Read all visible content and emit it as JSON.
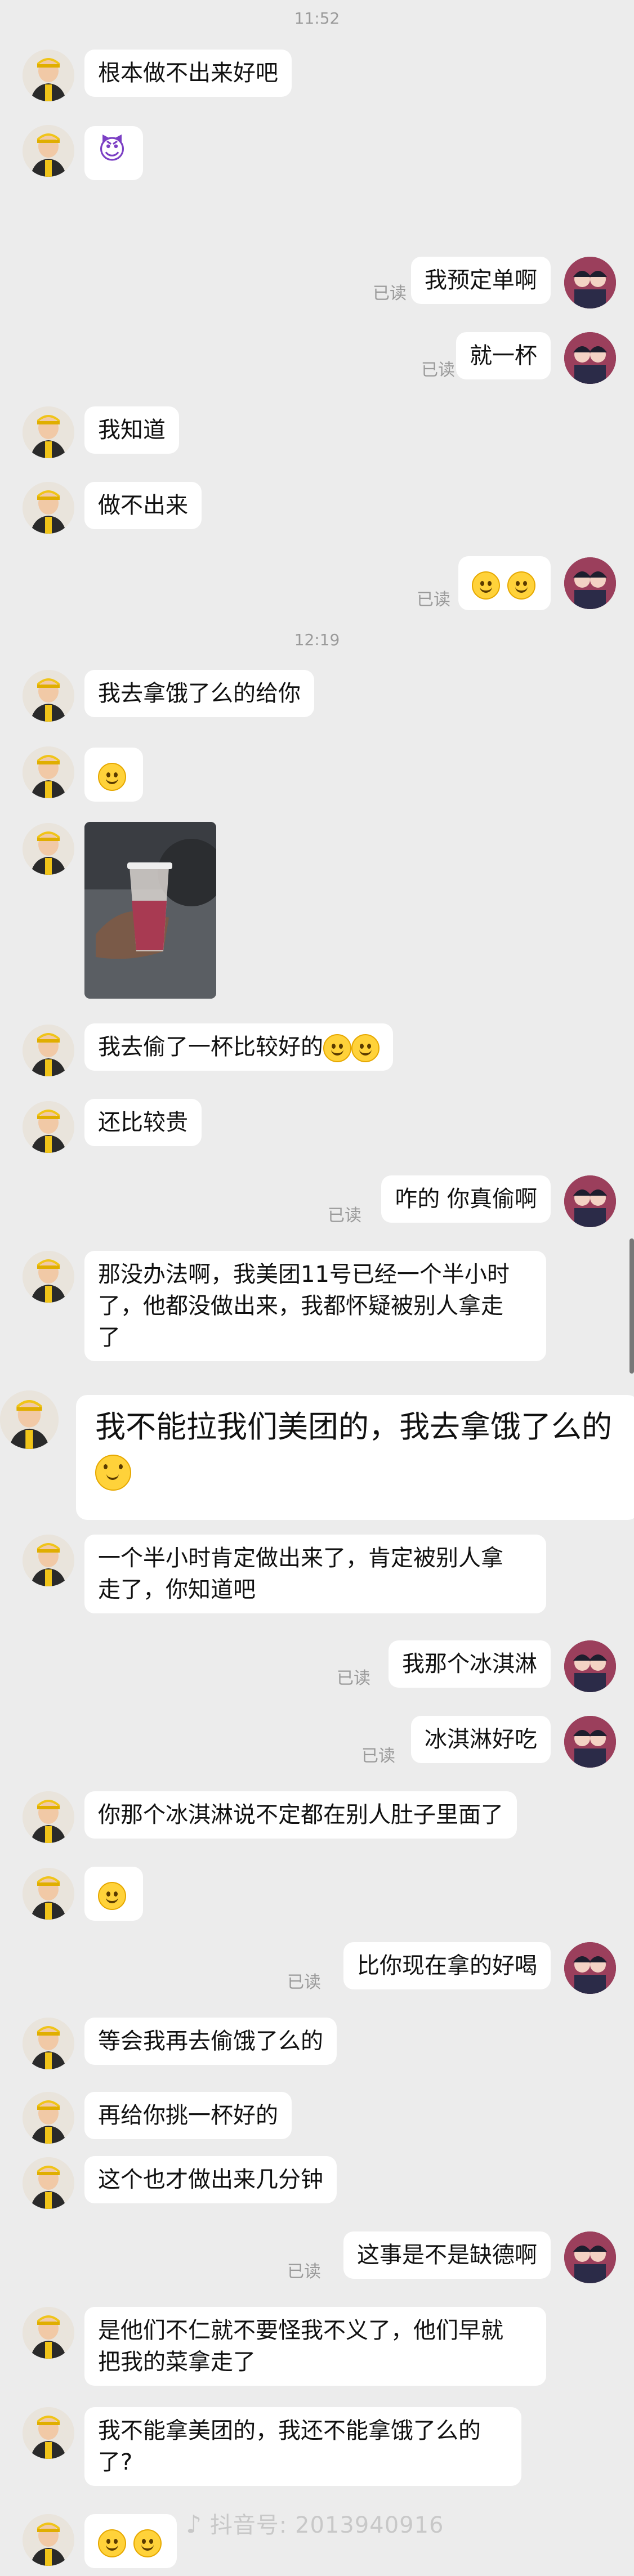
{
  "times": [
    "11:52",
    "12:19"
  ],
  "read_label": "已读",
  "messages": [
    {
      "text": "根本做不出来好吧"
    },
    {
      "text": ""
    },
    {
      "text": "我预定单啊"
    },
    {
      "text": "就一杯"
    },
    {
      "text": "我知道"
    },
    {
      "text": "做不出来"
    },
    {
      "text": ""
    },
    {
      "text": "我去拿饿了么的给你"
    },
    {
      "text": ""
    },
    {
      "text": ""
    },
    {
      "text": "我去偷了一杯比较好的"
    },
    {
      "text": "还比较贵"
    },
    {
      "text": "咋的 你真偷啊"
    },
    {
      "text": "那没办法啊，我美团11号已经一个半小时\n了，他都没做出来，我都怀疑被别人拿走\n了"
    },
    {
      "text": "我不能拉我们美团的，我去拿饿了么的"
    },
    {
      "text": "一个半小时肯定做出来了，肯定被别人拿\n走了，你知道吧"
    },
    {
      "text": "我那个冰淇淋"
    },
    {
      "text": "冰淇淋好吃"
    },
    {
      "text": "你那个冰淇淋说不定都在别人肚子里面了"
    },
    {
      "text": ""
    },
    {
      "text": "比你现在拿的好喝"
    },
    {
      "text": "等会我再去偷饿了么的"
    },
    {
      "text": "再给你挑一杯好的"
    },
    {
      "text": "这个也才做出来几分钟"
    },
    {
      "text": "这事是不是缺德啊"
    },
    {
      "text": "是他们不仁就不要怪我不义了，他们早就\n把我的菜拿走了"
    },
    {
      "text": "我不能拿美团的，我还不能拿饿了么的\n了?"
    },
    {
      "text": ""
    }
  ],
  "icons": {
    "devil": "😈",
    "smile": "smile-emoji",
    "dizzy": "dizzy-face-emoji",
    "hush": "shushing-face-emoji"
  },
  "watermark": {
    "logo": "♪",
    "text": "抖音号: 2013940916"
  },
  "colors": {
    "background": "#ececec",
    "bubble": "#ffffff",
    "time": "#9a9a9a"
  }
}
